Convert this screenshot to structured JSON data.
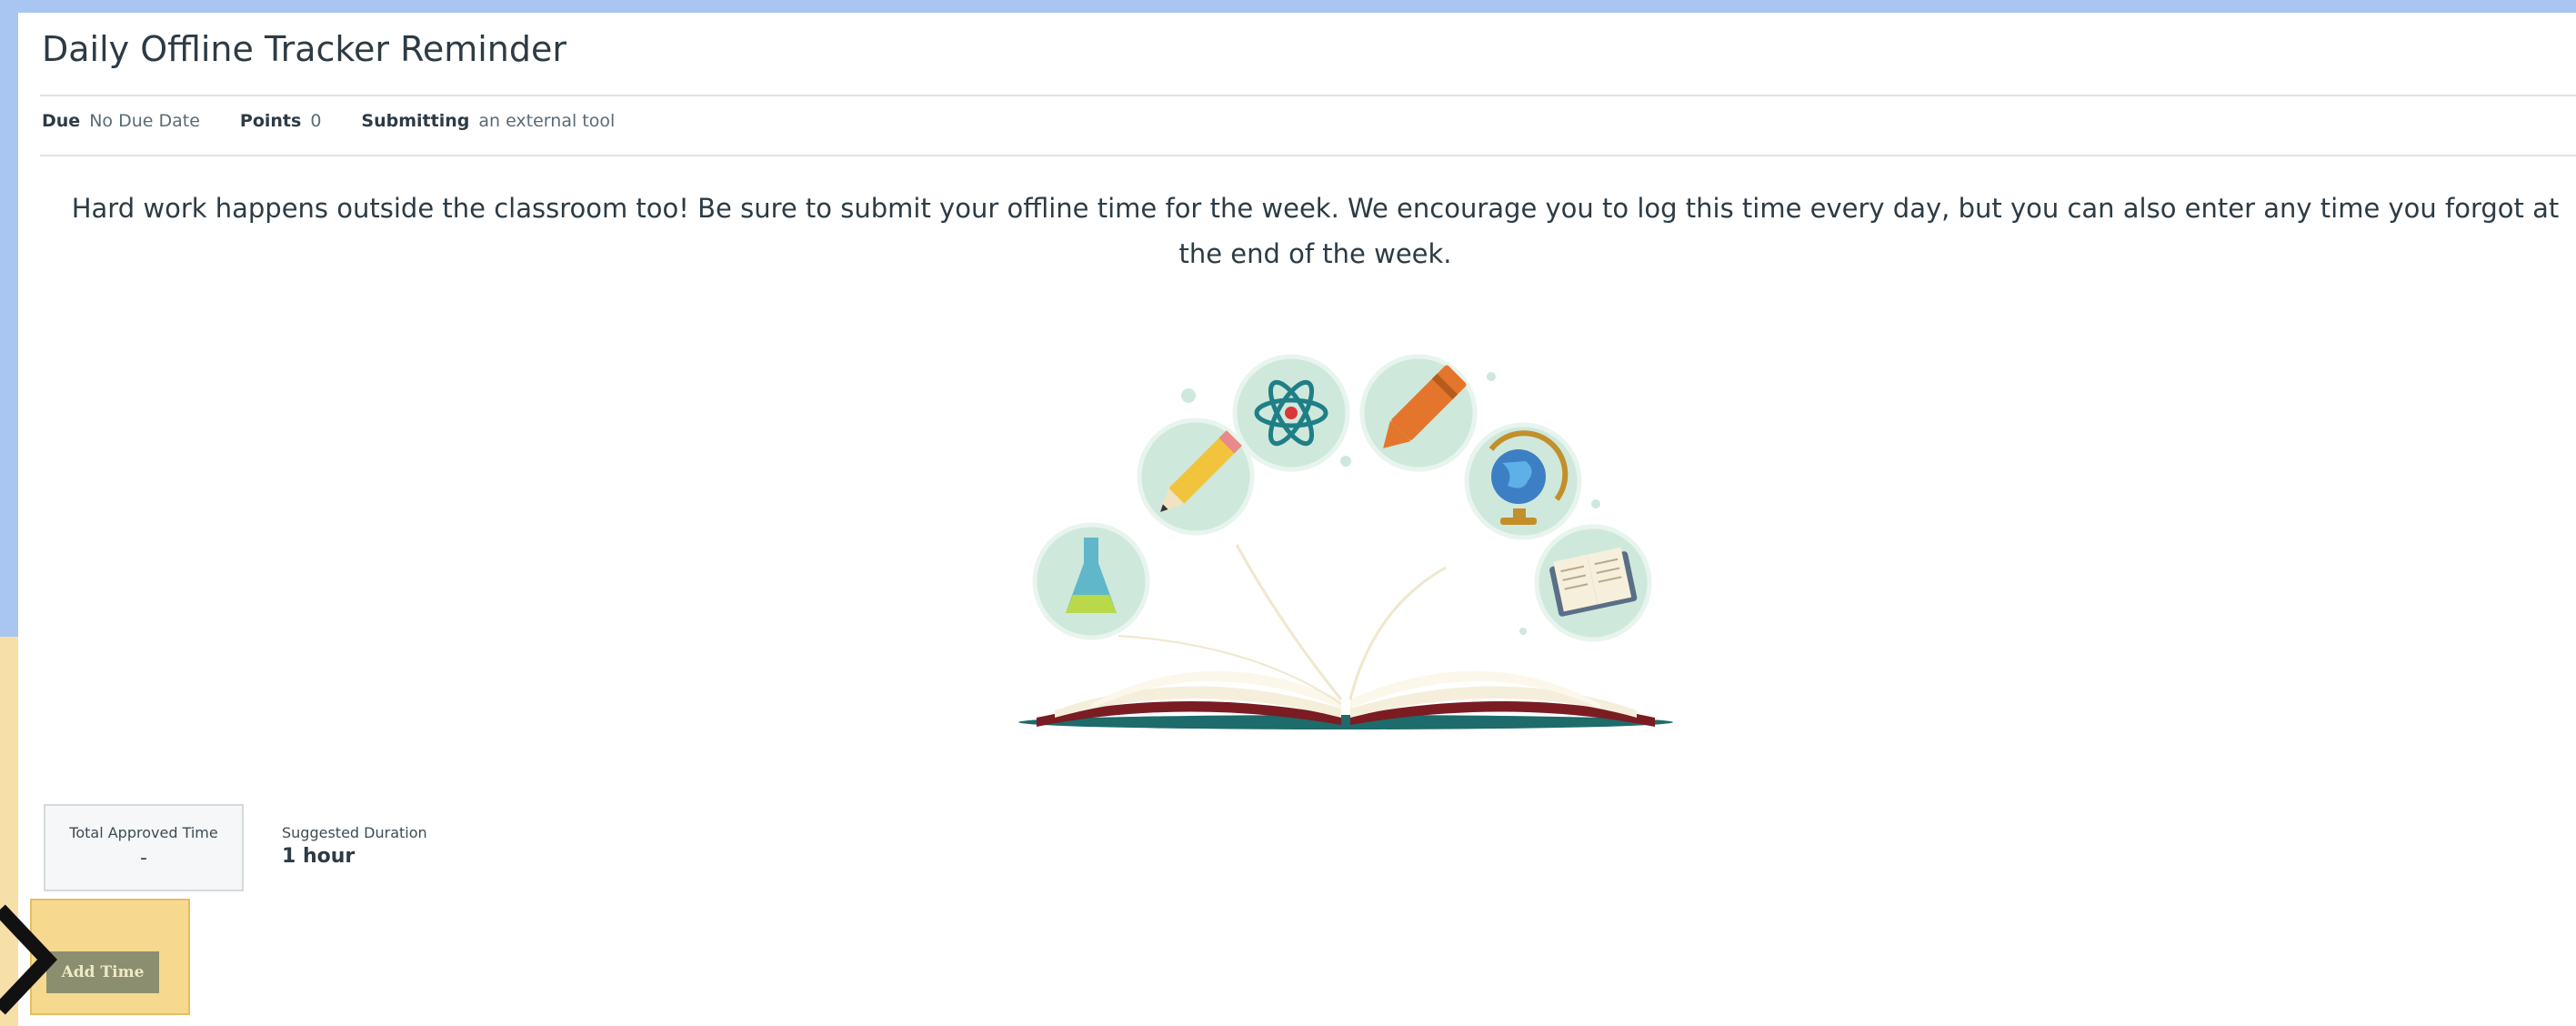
{
  "assignment": {
    "title": "Daily Offline Tracker Reminder",
    "details": {
      "due_label": "Due",
      "due_value": "No Due Date",
      "points_label": "Points",
      "points_value": "0",
      "submitting_label": "Submitting",
      "submitting_value": "an external tool"
    },
    "description": "Hard work happens outside the classroom too! Be sure to submit your  offline time for the week.  We encourage you to log this time every day, but you can also enter any time you forgot at the end of the week."
  },
  "illustration": {
    "icons": [
      "flask-icon",
      "pencil-icon",
      "atom-icon",
      "crayon-icon",
      "globe-icon",
      "open-book-icon"
    ]
  },
  "tracker": {
    "approved_label": "Total Approved Time",
    "approved_value": "-",
    "duration_label": "Suggested Duration",
    "duration_value": "1 hour",
    "add_button": "Add Time"
  },
  "colors": {
    "frame_blue": "#a9c6f2",
    "highlight_yellow": "#f7d88f",
    "button_olive": "#8b8f70",
    "icon_circle": "#cfe8dc"
  }
}
